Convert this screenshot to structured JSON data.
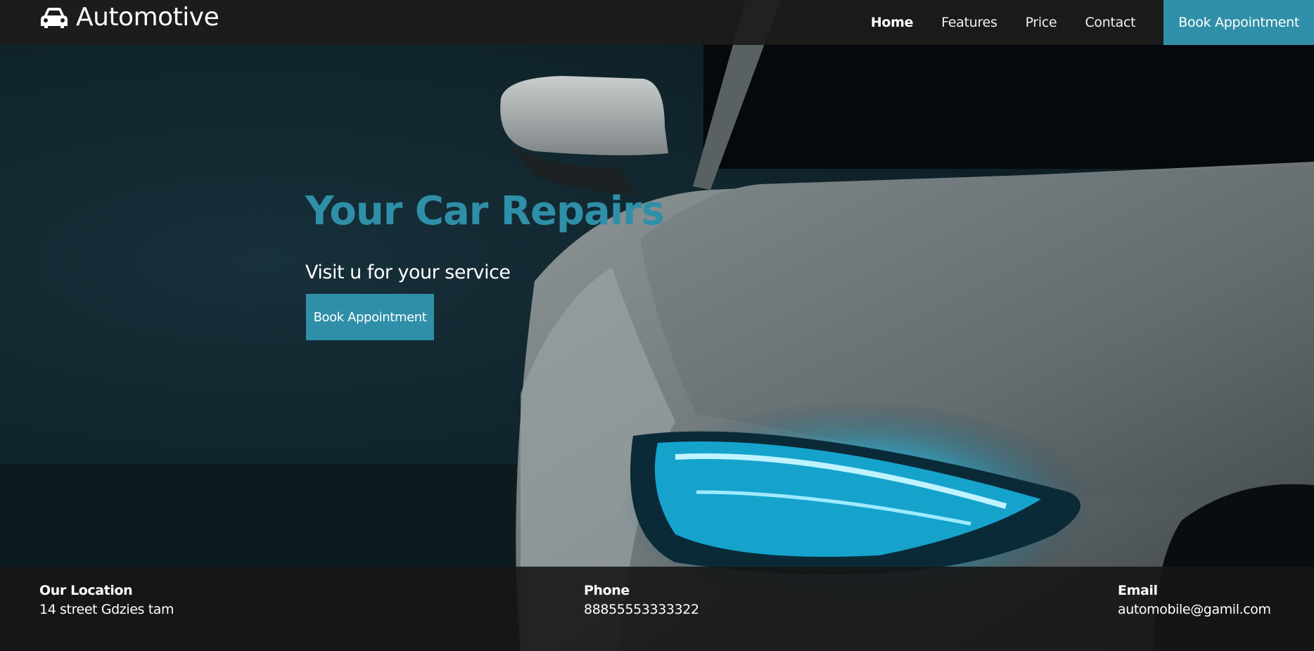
{
  "brand": {
    "name": "Automotive",
    "icon": "car-icon"
  },
  "nav": {
    "links": [
      {
        "label": "Home",
        "active": true
      },
      {
        "label": "Features",
        "active": false
      },
      {
        "label": "Price",
        "active": false
      },
      {
        "label": "Contact",
        "active": false
      }
    ],
    "cta_label": "Book Appointment"
  },
  "hero": {
    "title": "Your Car Repairs",
    "subtitle": "Visit u for your service",
    "button_label": "Book Appointment"
  },
  "footer": {
    "location": {
      "label": "Our Location",
      "value": "14 street Gdzies tam"
    },
    "phone": {
      "label": "Phone",
      "value": "88855553333322"
    },
    "email": {
      "label": "Email",
      "value": "automobile@gamil.com"
    }
  },
  "colors": {
    "accent": "#2f8fa8",
    "navbar": "#1c1c1c",
    "headlight": "#18c6f2"
  }
}
